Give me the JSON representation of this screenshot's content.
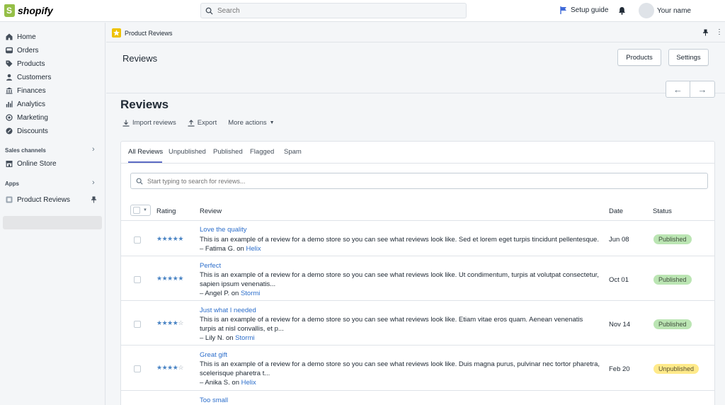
{
  "topbar": {
    "brand": "shopify",
    "search_placeholder": "Search",
    "setup_guide": "Setup guide",
    "user_name": "Your name"
  },
  "sidebar": {
    "items": [
      {
        "label": "Home",
        "icon": "home-icon"
      },
      {
        "label": "Orders",
        "icon": "orders-icon"
      },
      {
        "label": "Products",
        "icon": "tag-icon"
      },
      {
        "label": "Customers",
        "icon": "person-icon"
      },
      {
        "label": "Finances",
        "icon": "bank-icon"
      },
      {
        "label": "Analytics",
        "icon": "bar-chart-icon"
      },
      {
        "label": "Marketing",
        "icon": "target-icon"
      },
      {
        "label": "Discounts",
        "icon": "discount-icon"
      }
    ],
    "sales_channels_label": "Sales channels",
    "online_store": "Online Store",
    "apps_label": "Apps",
    "product_reviews": "Product Reviews"
  },
  "app_header": {
    "title": "Product Reviews"
  },
  "titlebar": {
    "title": "Reviews",
    "products_button": "Products",
    "settings_button": "Settings"
  },
  "page": {
    "title": "Reviews",
    "import": "Import reviews",
    "export": "Export",
    "more_actions": "More actions"
  },
  "tabs": [
    "All Reviews",
    "Unpublished",
    "Published",
    "Flagged",
    "Spam"
  ],
  "filter_placeholder": "Start typing to search for reviews...",
  "table": {
    "headers": {
      "rating": "Rating",
      "review": "Review",
      "date": "Date",
      "status": "Status"
    },
    "rows": [
      {
        "rating": 5,
        "title": "Love the quality",
        "body": "This is an example of a review for a demo store so you can see what reviews look like. Sed et lorem eget turpis tincidunt pellentesque.",
        "author": "– Fatima G. on",
        "product": "Helix",
        "date": "Jun 08",
        "status": "Published"
      },
      {
        "rating": 5,
        "title": "Perfect",
        "body": "This is an example of a review for a demo store so you can see what reviews look like. Ut condimentum, turpis at volutpat consectetur, sapien ipsum venenatis...",
        "author": "– Angel P. on",
        "product": "Stormi",
        "date": "Oct 01",
        "status": "Published"
      },
      {
        "rating": 4,
        "title": "Just what I needed",
        "body": "This is an example of a review for a demo store so you can see what reviews look like. Etiam vitae eros quam. Aenean venenatis turpis at nisl convallis, et p...",
        "author": "– Lily N. on",
        "product": "Stormi",
        "date": "Nov 14",
        "status": "Published"
      },
      {
        "rating": 4,
        "title": "Great gift",
        "body": "This is an example of a review for a demo store so you can see what reviews look like. Duis magna purus, pulvinar nec tortor pharetra, scelerisque pharetra t...",
        "author": "– Anika S. on",
        "product": "Helix",
        "date": "Feb 20",
        "status": "Unpublished"
      },
      {
        "rating": 0,
        "title": "Too small",
        "body": "",
        "author": "",
        "product": "",
        "date": "",
        "status": ""
      }
    ]
  },
  "colors": {
    "published_bg": "#bbe5b3",
    "unpublished_bg": "#ffea8a",
    "link": "#2c6ecb",
    "star": "#4a84c4",
    "tab_accent": "#5c6ac4"
  }
}
